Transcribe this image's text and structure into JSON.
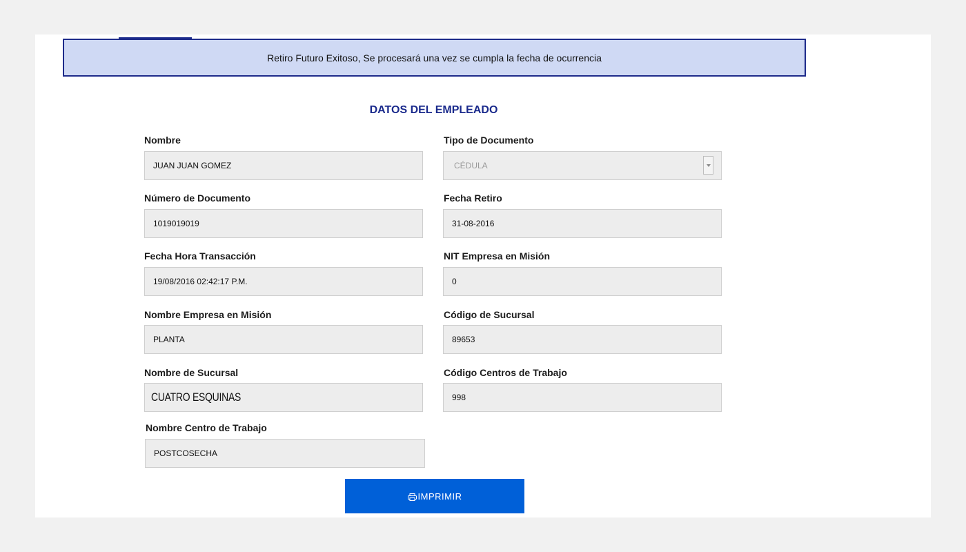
{
  "alert": {
    "message": "Retiro Futuro Exitoso, Se procesará una vez se cumpla la fecha de ocurrencia"
  },
  "section": {
    "title": "DATOS DEL EMPLEADO"
  },
  "fields": {
    "nombre": {
      "label": "Nombre",
      "value": "JUAN JUAN GOMEZ"
    },
    "tipo_documento": {
      "label": "Tipo de Documento",
      "value": "CÉDULA"
    },
    "numero_documento": {
      "label": "Número de Documento",
      "value": "1019019019"
    },
    "fecha_retiro": {
      "label": "Fecha Retiro",
      "value": "31-08-2016"
    },
    "fecha_hora_transaccion": {
      "label": "Fecha Hora Transacción",
      "value": "19/08/2016 02:42:17 P.M."
    },
    "nit_empresa_mision": {
      "label": "NIT Empresa en Misión",
      "value": "0"
    },
    "nombre_empresa_mision": {
      "label": "Nombre Empresa en Misión",
      "value": "PLANTA"
    },
    "codigo_sucursal": {
      "label": "Código de Sucursal",
      "value": "89653"
    },
    "nombre_sucursal": {
      "label": "Nombre de Sucursal",
      "value": "CUATRO ESQUINAS"
    },
    "codigo_centros_trabajo": {
      "label": "Código Centros de Trabajo",
      "value": "998"
    },
    "nombre_centro_trabajo": {
      "label": "Nombre Centro de Trabajo",
      "value": "POSTCOSECHA"
    }
  },
  "actions": {
    "print_label": "IMPRIMIR",
    "print_icon": "printer-icon"
  },
  "colors": {
    "accent": "#0060d8",
    "title": "#1a2a8c",
    "alert_bg": "#cfd9f4",
    "alert_border": "#1d2a8a"
  }
}
